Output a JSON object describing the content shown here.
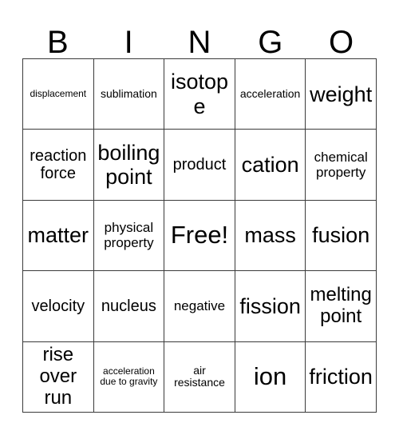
{
  "card": {
    "title": "BINGO",
    "header_letters": [
      "B",
      "I",
      "N",
      "G",
      "O"
    ],
    "background_color": "#ffffff",
    "text_color": "#000000",
    "border_color": "#3b3b3b",
    "rows": [
      [
        {
          "label": "displacement",
          "size": "xs"
        },
        {
          "label": "sublimation",
          "size": "sm"
        },
        {
          "label": "isotope",
          "size": "xxl"
        },
        {
          "label": "acceleration",
          "size": "sm"
        },
        {
          "label": "weight",
          "size": "xxl"
        }
      ],
      [
        {
          "label": "reaction force",
          "size": "lg"
        },
        {
          "label": "boiling point",
          "size": "xxl"
        },
        {
          "label": "product",
          "size": "lg"
        },
        {
          "label": "cation",
          "size": "xxl"
        },
        {
          "label": "chemical property",
          "size": "md"
        }
      ],
      [
        {
          "label": "matter",
          "size": "xxl"
        },
        {
          "label": "physical property",
          "size": "md"
        },
        {
          "label": "Free!",
          "size": "huge"
        },
        {
          "label": "mass",
          "size": "xxl"
        },
        {
          "label": "fusion",
          "size": "xxl"
        }
      ],
      [
        {
          "label": "velocity",
          "size": "lg"
        },
        {
          "label": "nucleus",
          "size": "lg"
        },
        {
          "label": "negative",
          "size": "md"
        },
        {
          "label": "fission",
          "size": "xxl"
        },
        {
          "label": "melting point",
          "size": "xl"
        }
      ],
      [
        {
          "label": "rise over run",
          "size": "xl"
        },
        {
          "label": "acceleration due to gravity",
          "size": "xs"
        },
        {
          "label": "air resistance",
          "size": "sm"
        },
        {
          "label": "ion",
          "size": "huge"
        },
        {
          "label": "friction",
          "size": "xxl"
        }
      ]
    ]
  }
}
